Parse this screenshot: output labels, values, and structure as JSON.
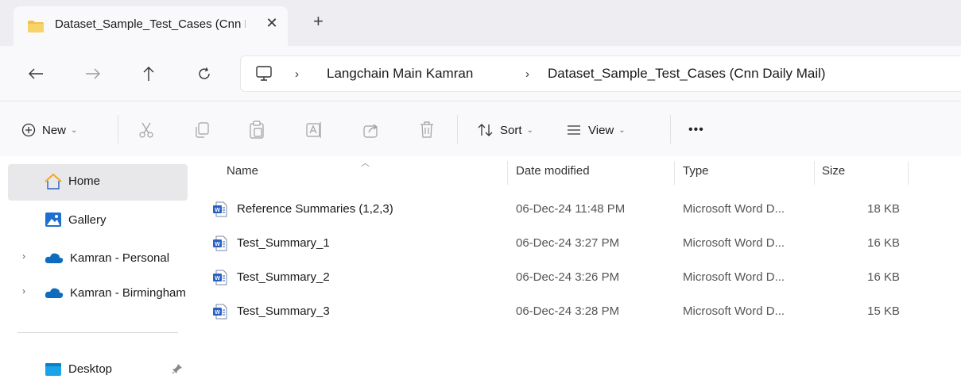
{
  "tab": {
    "title": "Dataset_Sample_Test_Cases (Cnn Daily Mail)",
    "close_glyph": "✕",
    "new_tab_glyph": "+"
  },
  "nav": {
    "back_glyph": "←",
    "forward_glyph": "→",
    "up_glyph": "↑",
    "refresh_glyph": "↻"
  },
  "breadcrumb": {
    "separator": "›",
    "items": [
      "Langchain Main Kamran",
      "Dataset_Sample_Test_Cases (Cnn Daily Mail)"
    ]
  },
  "toolbar": {
    "new_label": "New",
    "sort_label": "Sort",
    "view_label": "View",
    "more_label": "•••",
    "chevron": "⌄"
  },
  "sidebar": {
    "expand_glyph": "›",
    "items": [
      {
        "label": "Home",
        "icon": "home-icon"
      },
      {
        "label": "Gallery",
        "icon": "gallery-icon"
      },
      {
        "label": "Kamran - Personal",
        "icon": "onedrive-icon"
      },
      {
        "label": "Kamran - Birmingham",
        "icon": "onedrive-icon"
      },
      {
        "label": "Desktop",
        "icon": "desktop-folder-icon"
      }
    ],
    "pin_glyph": "📌"
  },
  "columns": {
    "name": "Name",
    "date": "Date modified",
    "type": "Type",
    "size": "Size"
  },
  "files": [
    {
      "name": "Reference Summaries (1,2,3)",
      "date": "06-Dec-24 11:48 PM",
      "type": "Microsoft Word D...",
      "size": "18 KB"
    },
    {
      "name": "Test_Summary_1",
      "date": "06-Dec-24 3:27 PM",
      "type": "Microsoft Word D...",
      "size": "16 KB"
    },
    {
      "name": "Test_Summary_2",
      "date": "06-Dec-24 3:26 PM",
      "type": "Microsoft Word D...",
      "size": "16 KB"
    },
    {
      "name": "Test_Summary_3",
      "date": "06-Dec-24 3:28 PM",
      "type": "Microsoft Word D...",
      "size": "15 KB"
    }
  ],
  "colors": {
    "folder": "#f2c04a",
    "word": "#2b62c2",
    "onedrive": "#0f6cbd",
    "gallery": "#1f6fd1",
    "home_roof": "#f5a623"
  }
}
